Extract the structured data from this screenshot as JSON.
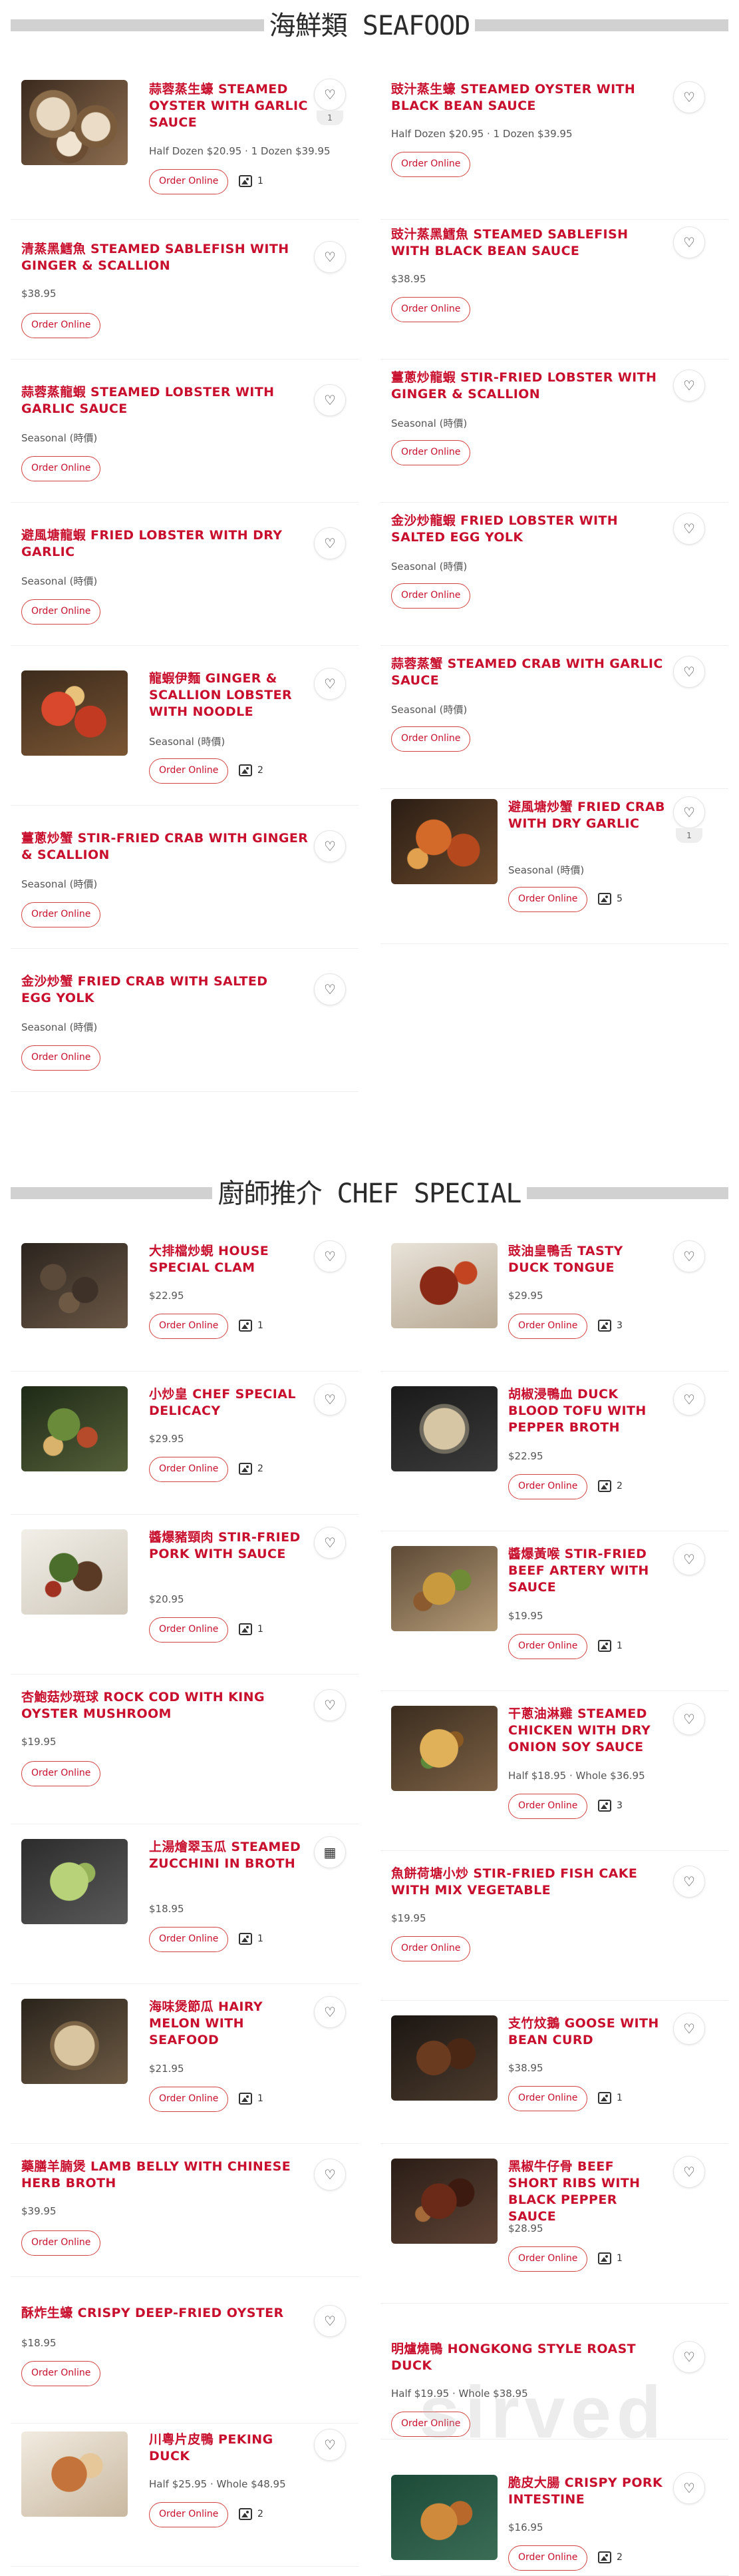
{
  "sections": [
    {
      "title": "海鮮類 SEAFOOD"
    },
    {
      "title": "廚師推介 CHEF SPECIAL"
    }
  ],
  "colors": {
    "accent": "#c8102e",
    "button_border": "#d24444",
    "divider": "#eeeeee"
  },
  "icons": {
    "favorite": "heart-icon",
    "photos": "image-icon",
    "favorite_alt": "calendar-icon"
  },
  "common": {
    "order_online": "Order Online"
  },
  "seafood": [
    {
      "name": "蒜蓉蒸生蠔 STEAMED OYSTER WITH GARLIC SAUCE",
      "price": "Half Dozen $20.95 · 1 Dozen $39.95",
      "photos": "1",
      "fav_count": "1"
    },
    {
      "name": "豉汁蒸生蠔 STEAMED OYSTER WITH BLACK BEAN SAUCE",
      "price": "Half Dozen $20.95 · 1 Dozen $39.95"
    },
    {
      "name": "清蒸黑鱈魚 STEAMED SABLEFISH WITH GINGER & SCALLION",
      "price": "$38.95"
    },
    {
      "name": "豉汁蒸黑鱈魚 STEAMED SABLEFISH WITH BLACK BEAN SAUCE",
      "price": "$38.95"
    },
    {
      "name": "蒜蓉蒸龍蝦 STEAMED LOBSTER WITH GARLIC SAUCE",
      "price": "Seasonal (時價)"
    },
    {
      "name": "薑蔥炒龍蝦 STIR-FRIED LOBSTER WITH GINGER & SCALLION",
      "price": "Seasonal (時價)"
    },
    {
      "name": "避風塘龍蝦 FRIED LOBSTER WITH DRY GARLIC",
      "price": "Seasonal (時價)"
    },
    {
      "name": "金沙炒龍蝦 FRIED LOBSTER WITH SALTED EGG YOLK",
      "price": "Seasonal (時價)"
    },
    {
      "name": "龍蝦伊麵 GINGER & SCALLION LOBSTER WITH NOODLE",
      "price": "Seasonal (時價)",
      "photos": "2"
    },
    {
      "name": "蒜蓉蒸蟹 STEAMED CRAB WITH GARLIC SAUCE",
      "price": "Seasonal (時價)"
    },
    {
      "name": "薑蔥炒蟹 STIR-FRIED CRAB WITH GINGER & SCALLION",
      "price": "Seasonal (時價)"
    },
    {
      "name": "避風塘炒蟹 FRIED CRAB WITH DRY GARLIC",
      "price": "Seasonal (時價)",
      "photos": "5",
      "fav_count": "1"
    },
    {
      "name": "金沙炒蟹 FRIED CRAB WITH SALTED EGG YOLK",
      "price": "Seasonal (時價)"
    }
  ],
  "chef": [
    {
      "name": "大排檔炒蜆 HOUSE SPECIAL CLAM",
      "price": "$22.95",
      "photos": "1"
    },
    {
      "name": "豉油皇鴨舌 TASTY DUCK TONGUE",
      "price": "$29.95",
      "photos": "3"
    },
    {
      "name": "小炒皇 CHEF SPECIAL DELICACY",
      "price": "$29.95",
      "photos": "2"
    },
    {
      "name": "胡椒浸鴨血 DUCK BLOOD TOFU WITH PEPPER BROTH",
      "price": "$22.95",
      "photos": "2"
    },
    {
      "name": "醬爆豬頸肉 STIR-FRIED PORK WITH SAUCE",
      "price": "$20.95",
      "photos": "1"
    },
    {
      "name": "醬爆黃喉 STIR-FRIED BEEF ARTERY WITH SAUCE",
      "price": "$19.95",
      "photos": "1"
    },
    {
      "name": "杏鮑菇炒斑球 ROCK COD WITH KING OYSTER MUSHROOM",
      "price": "$19.95"
    },
    {
      "name": "干蔥油淋雞 STEAMED CHICKEN WITH DRY ONION SOY SAUCE",
      "price": "Half $18.95 · Whole $36.95",
      "photos": "3"
    },
    {
      "name": "上湯燴翠玉瓜 STEAMED ZUCCHINI IN BROTH",
      "price": "$18.95",
      "photos": "1"
    },
    {
      "name": "魚餅荷塘小炒 STIR-FRIED FISH CAKE WITH MIX VEGETABLE",
      "price": "$19.95"
    },
    {
      "name": "海味煲節瓜 HAIRY MELON WITH SEAFOOD",
      "price": "$21.95",
      "photos": "1"
    },
    {
      "name": "支竹炆鵝 GOOSE WITH BEAN CURD",
      "price": "$38.95",
      "photos": "1"
    },
    {
      "name": "藥膳羊腩煲 LAMB BELLY WITH CHINESE HERB BROTH",
      "price": "$39.95"
    },
    {
      "name": "黑椒牛仔骨 BEEF SHORT RIBS WITH BLACK PEPPER SAUCE",
      "price": "$28.95",
      "photos": "1"
    },
    {
      "name": "酥炸生蠔 CRISPY DEEP-FRIED OYSTER",
      "price": "$18.95"
    },
    {
      "name": "明爐燒鴨 HONGKONG STYLE ROAST DUCK",
      "price": "Half $19.95 · Whole $38.95"
    },
    {
      "name": "川粵片皮鴨 PEKING DUCK",
      "price": "Half $25.95 · Whole $48.95",
      "photos": "2"
    },
    {
      "name": "脆皮大腸 CRISPY PORK INTESTINE",
      "price": "$16.95",
      "photos": "2"
    }
  ],
  "watermark": "sirved"
}
